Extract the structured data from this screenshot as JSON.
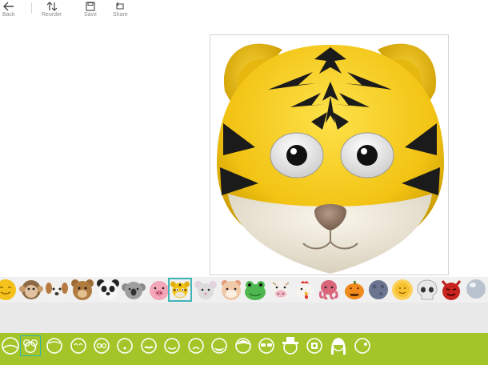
{
  "toolbar": {
    "back_label": "Back",
    "reorder_label": "Reorder",
    "save_label": "Save",
    "share_label": "Share"
  },
  "canvas": {
    "emoji": "tiger",
    "palette": {
      "yellow": "#f2c313",
      "stripe": "#1b1b1b",
      "muzzle": "#ece6d6"
    }
  },
  "emoji_strip": {
    "items": [
      "sun-face",
      "monkey",
      "dog",
      "bear",
      "panda",
      "koala",
      "pig",
      "tiger",
      "mouse",
      "hamster",
      "frog",
      "cow",
      "rooster",
      "octopus",
      "pumpkin",
      "new-moon-face",
      "sun-with-face",
      "skull",
      "devil",
      "crystal-ball"
    ],
    "selected": "tiger"
  },
  "feature_bar": {
    "items": [
      "face-shape",
      "ears",
      "face-outline",
      "eyes-face",
      "glasses-face",
      "mouth-face",
      "mustache-face",
      "smile-face",
      "nose-face",
      "beard-face",
      "hair-face",
      "sunglasses-face",
      "hat-face",
      "badge-face",
      "long-hair-face",
      "side-face"
    ],
    "selected": "ears",
    "colors": {
      "bar": "#a3c52a",
      "selection": "#2fb3b3"
    }
  }
}
